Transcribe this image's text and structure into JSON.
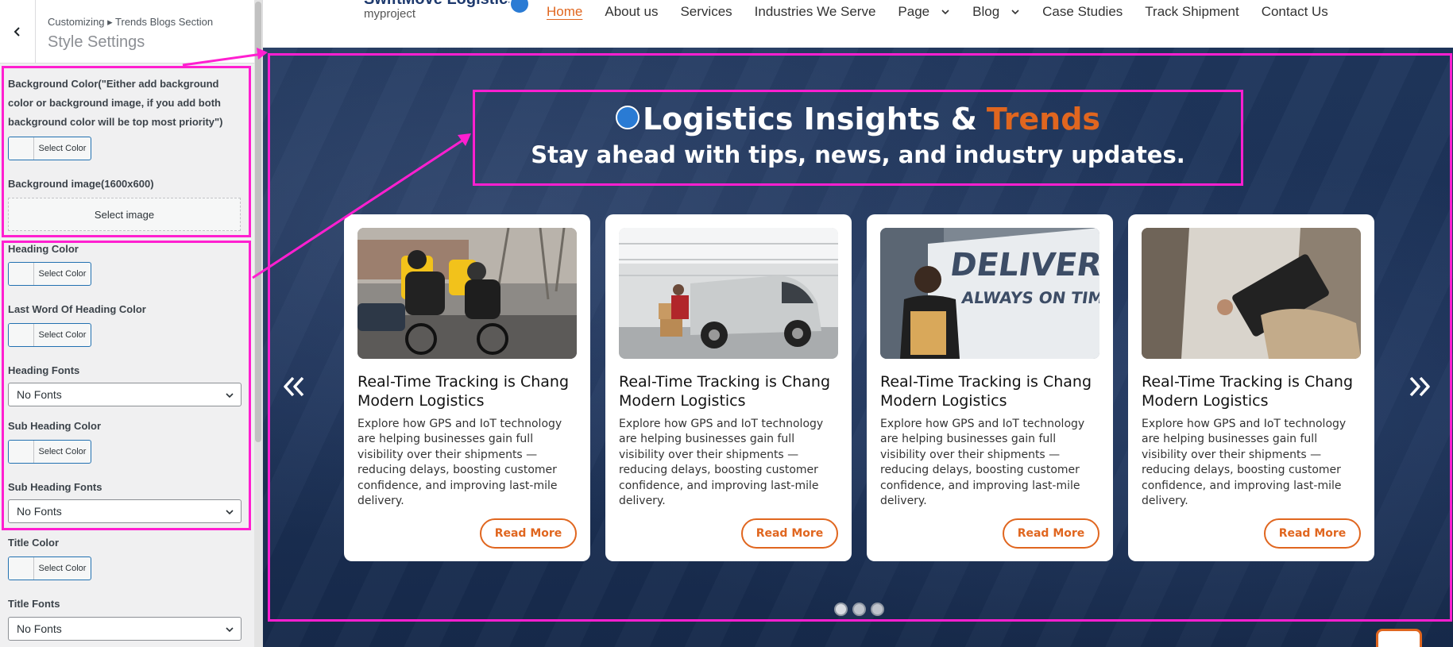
{
  "customizer": {
    "breadcrumb": "Customizing ▸ Trends Blogs Section",
    "panel_title": "Style Settings",
    "bg_color_label": "Background Color(\"Either add background color or background image, if you add both background color will be top most priority\")",
    "bg_image_label": "Background image(1600x600)",
    "select_image": "Select image",
    "select_color": "Select Color",
    "heading_color_label": "Heading Color",
    "last_word_color_label": "Last Word Of Heading Color",
    "heading_fonts_label": "Heading Fonts",
    "sub_heading_color_label": "Sub Heading Color",
    "sub_heading_fonts_label": "Sub Heading Fonts",
    "title_color_label": "Title Color",
    "title_fonts_label": "Title Fonts",
    "no_fonts": "No Fonts"
  },
  "site": {
    "title": "SwiftMove Logistics",
    "tagline": "myproject",
    "nav": [
      {
        "label": "Home",
        "active": true
      },
      {
        "label": "About us"
      },
      {
        "label": "Services"
      },
      {
        "label": "Industries We Serve"
      },
      {
        "label": "Page",
        "dropdown": true
      },
      {
        "label": "Blog",
        "dropdown": true
      },
      {
        "label": "Case Studies"
      },
      {
        "label": "Track Shipment"
      },
      {
        "label": "Contact Us"
      }
    ]
  },
  "trends": {
    "heading": "Logistics Insights &",
    "heading_last_word": "Trends",
    "subheading": "Stay ahead with tips, news, and industry updates.",
    "cards": [
      {
        "title": "Real-Time Tracking is Chang Modern Logistics",
        "desc": "Explore how GPS and IoT technology are helping businesses gain full visibility over their shipments — reducing delays, boosting customer confidence, and improving last-mile delivery.",
        "button": "Read More",
        "image": "couriers-on-bicycles"
      },
      {
        "title": "Real-Time Tracking is Chang Modern Logistics",
        "desc": "Explore how GPS and IoT technology are helping businesses gain full visibility over their shipments — reducing delays, boosting customer confidence, and improving last-mile delivery.",
        "button": "Read More",
        "image": "van-loading-boxes"
      },
      {
        "title": "Real-Time Tracking is Chang Modern Logistics",
        "desc": "Explore how GPS and IoT technology are helping businesses gain full visibility over their shipments — reducing delays, boosting customer confidence, and improving last-mile delivery.",
        "button": "Read More",
        "image": "delivery-woman-van",
        "image_text": "DELIVERY ALWAYS ON TIME"
      },
      {
        "title": "Real-Time Tracking is Chang Modern Logistics",
        "desc": "Explore how GPS and IoT technology are helping businesses gain full visibility over their shipments — reducing delays, boosting customer confidence, and improving last-mile delivery.",
        "button": "Read More",
        "image": "tablet-package"
      }
    ],
    "dots": 3,
    "active_dot": 1
  },
  "colors": {
    "accent": "#e0661f",
    "section_bg": "#1f365c",
    "highlight": "#ff1fd0"
  }
}
